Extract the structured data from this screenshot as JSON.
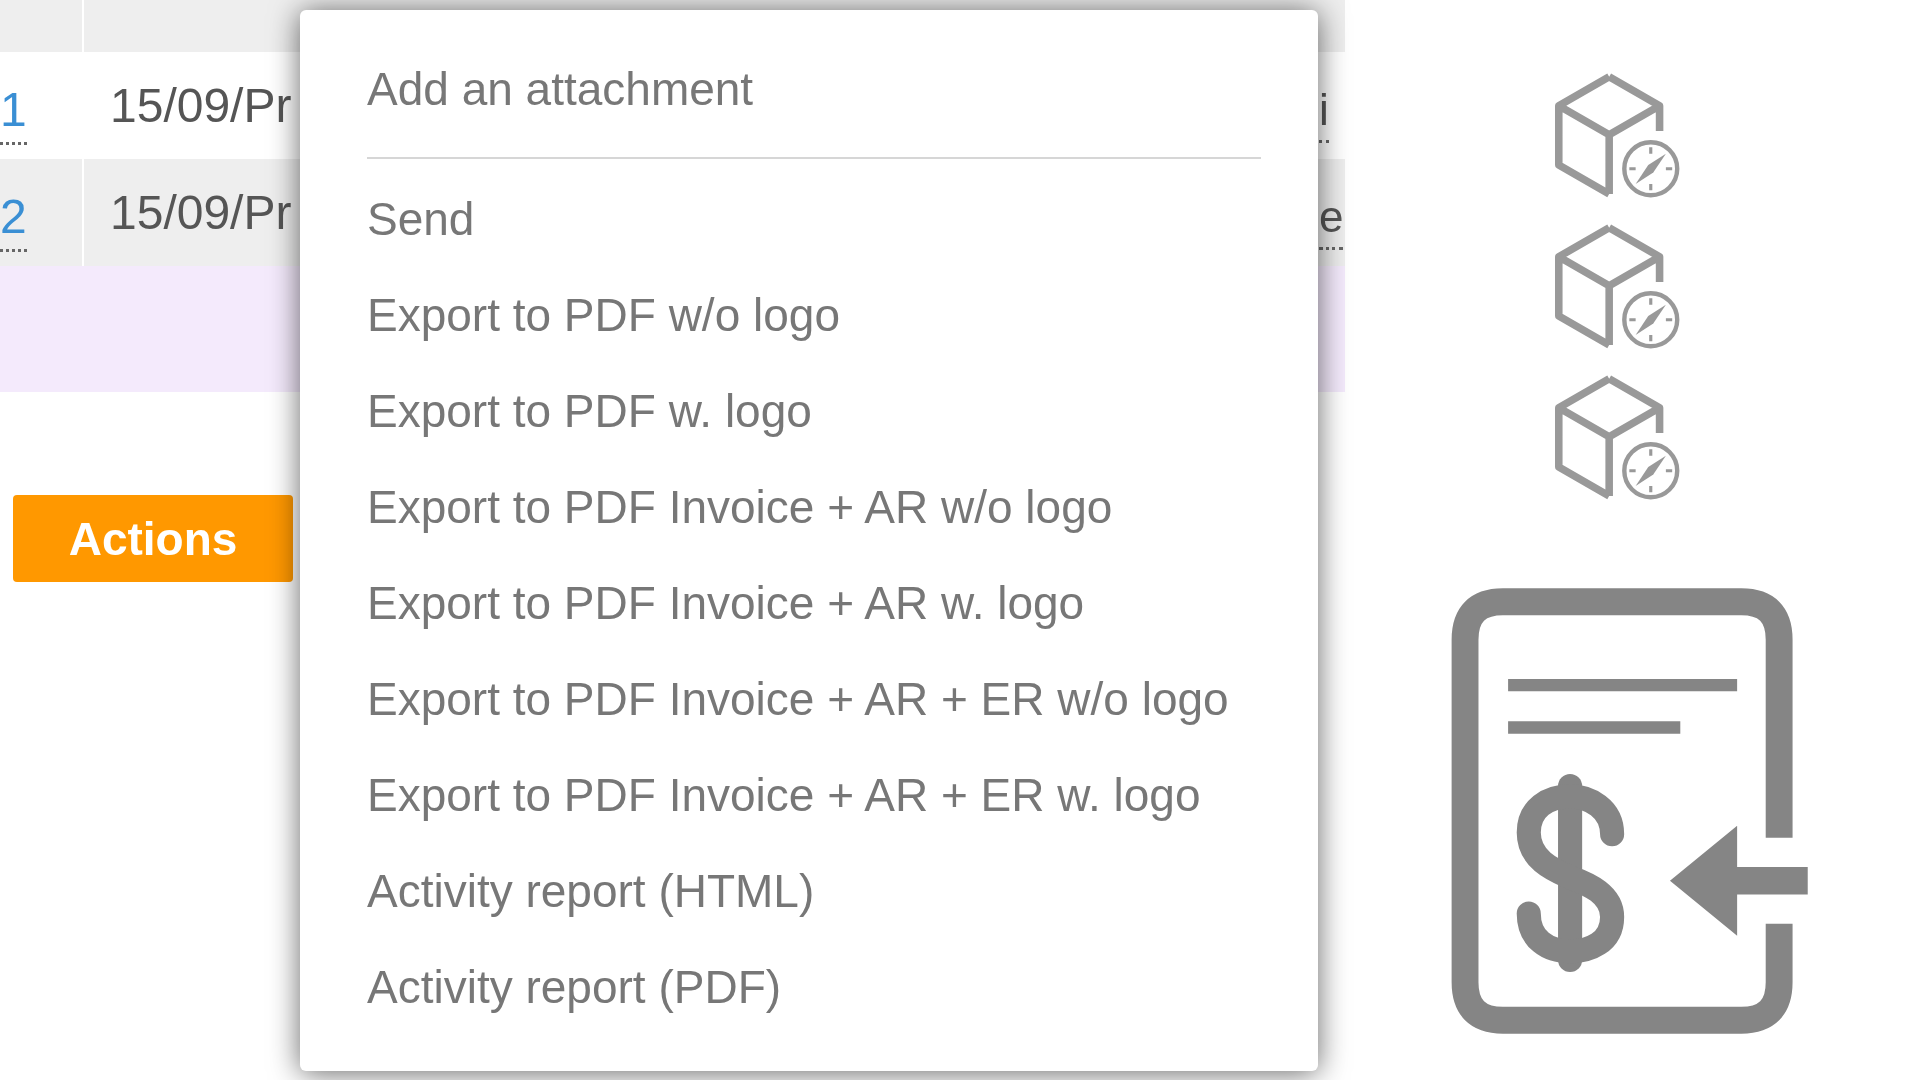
{
  "table": {
    "rows": [
      {
        "highlighted": false
      },
      {
        "highlighted": false,
        "column_1": "1",
        "column_2": "15/09/Pr",
        "column_3": "i"
      },
      {
        "highlighted": false,
        "column_1": "2",
        "column_2": "15/09/Pr",
        "column_3": "e"
      },
      {
        "highlighted": true
      }
    ]
  },
  "actions_button": {
    "label": "Actions"
  },
  "menu": {
    "items": [
      {
        "kind": "item",
        "label": "Add an attachment"
      },
      {
        "kind": "separator"
      },
      {
        "kind": "item",
        "label": "Send"
      },
      {
        "kind": "item",
        "label": "Export to PDF w/o logo"
      },
      {
        "kind": "item",
        "label": "Export to PDF w. logo"
      },
      {
        "kind": "item",
        "label": "Export to PDF Invoice + AR w/o logo"
      },
      {
        "kind": "item",
        "label": "Export to PDF Invoice + AR w. logo"
      },
      {
        "kind": "item",
        "label": "Export to PDF Invoice + AR + ER w/o logo"
      },
      {
        "kind": "item",
        "label": "Export to PDF Invoice + AR + ER w. logo"
      },
      {
        "kind": "item",
        "label": "Activity report (HTML)"
      },
      {
        "kind": "item",
        "label": "Activity report (PDF)"
      }
    ]
  }
}
